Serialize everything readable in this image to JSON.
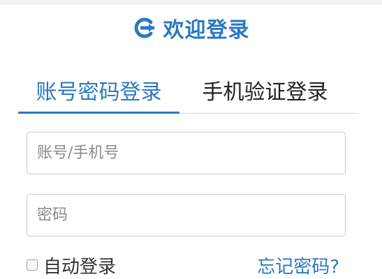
{
  "header": {
    "icon": "login-arrow-icon",
    "title": "欢迎登录"
  },
  "tabs": [
    {
      "label": "账号密码登录",
      "active": true
    },
    {
      "label": "手机验证登录",
      "active": false
    }
  ],
  "form": {
    "account_placeholder": "账号/手机号",
    "password_placeholder": "密码",
    "remember_label": "自动登录",
    "remember_checked": false,
    "forgot_label": "忘记密码?"
  },
  "colors": {
    "accent": "#2b78c2",
    "text": "#222222",
    "border": "#cccccc"
  }
}
